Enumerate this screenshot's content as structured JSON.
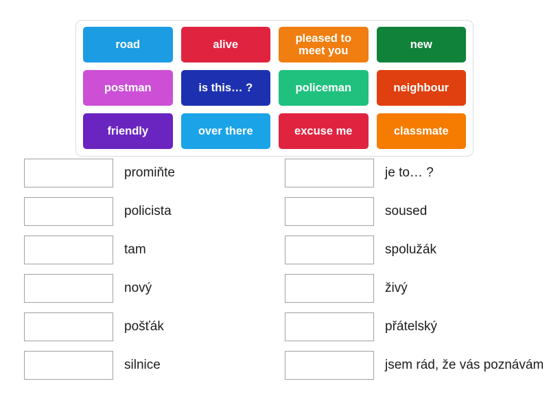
{
  "tile_bank": {
    "rows": [
      [
        {
          "label": "road",
          "color": "#1b9ce3"
        },
        {
          "label": "alive",
          "color": "#e02440"
        },
        {
          "label": "pleased to meet you",
          "color": "#f07e10"
        },
        {
          "label": "new",
          "color": "#118239"
        }
      ],
      [
        {
          "label": "postman",
          "color": "#cc4fd6"
        },
        {
          "label": "is this… ?",
          "color": "#1d31b0"
        },
        {
          "label": "policeman",
          "color": "#20c17e"
        },
        {
          "label": "neighbour",
          "color": "#e0400f"
        }
      ],
      [
        {
          "label": "friendly",
          "color": "#6a25c0"
        },
        {
          "label": "over there",
          "color": "#1ba3e8"
        },
        {
          "label": "excuse me",
          "color": "#e02440"
        },
        {
          "label": "classmate",
          "color": "#f57c00"
        }
      ]
    ]
  },
  "answers": {
    "left_column": [
      {
        "text": "promiňte"
      },
      {
        "text": "policista"
      },
      {
        "text": "tam"
      },
      {
        "text": "nový"
      },
      {
        "text": "pošťák"
      },
      {
        "text": "silnice"
      }
    ],
    "right_column": [
      {
        "text": "je to… ?"
      },
      {
        "text": "soused"
      },
      {
        "text": "spolužák"
      },
      {
        "text": "živý"
      },
      {
        "text": "přátelský"
      },
      {
        "text": "jsem rád, že vás poznávám"
      }
    ]
  }
}
